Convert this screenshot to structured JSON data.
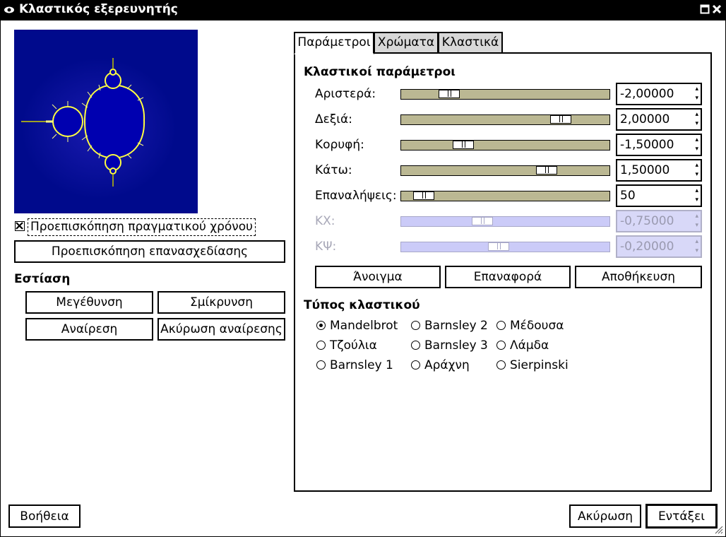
{
  "window": {
    "title": "Κλαστικός εξερευνητής"
  },
  "preview": {
    "realtime_label": "Προεπισκόπηση πραγματικού χρόνου",
    "realtime_checked": true,
    "redraw_label": "Προεπισκόπηση επανασχεδίασης"
  },
  "zoom": {
    "heading": "Εστίαση",
    "zoom_in": "Μεγέθυνση",
    "zoom_out": "Σμίκρυνση",
    "undo": "Αναίρεση",
    "redo": "Ακύρωση αναίρεσης"
  },
  "tabs": [
    {
      "label": "Παράμετροι",
      "active": true
    },
    {
      "label": "Χρώματα",
      "active": false
    },
    {
      "label": "Κλαστικά",
      "active": false
    }
  ],
  "parameters": {
    "heading": "Κλαστικοί παράμετροι",
    "rows": [
      {
        "label": "Αριστερά:",
        "value": "-2,00000",
        "slider_fraction": 0.2,
        "enabled": true
      },
      {
        "label": "Δεξιά:",
        "value": "2,00000",
        "slider_fraction": 0.8,
        "enabled": true
      },
      {
        "label": "Κορυφή:",
        "value": "-1,50000",
        "slider_fraction": 0.275,
        "enabled": true
      },
      {
        "label": "Κάτω:",
        "value": "1,50000",
        "slider_fraction": 0.725,
        "enabled": true
      },
      {
        "label": "Επαναλήψεις:",
        "value": "50",
        "slider_fraction": 0.065,
        "enabled": true
      },
      {
        "label": "ΚΧ:",
        "value": "-0,75000",
        "slider_fraction": 0.38,
        "enabled": false
      },
      {
        "label": "ΚΨ:",
        "value": "-0,20000",
        "slider_fraction": 0.465,
        "enabled": false
      }
    ],
    "open": "Άνοιγμα",
    "reset": "Επαναφορά",
    "save": "Αποθήκευση"
  },
  "fractal_type": {
    "heading": "Τύπος κλαστικού",
    "options": [
      {
        "label": "Mandelbrot",
        "selected": true
      },
      {
        "label": "Barnsley 2",
        "selected": false
      },
      {
        "label": "Μέδουσα",
        "selected": false
      },
      {
        "label": "Τζούλια",
        "selected": false
      },
      {
        "label": "Barnsley 3",
        "selected": false
      },
      {
        "label": "Λάμδα",
        "selected": false
      },
      {
        "label": "Barnsley 1",
        "selected": false
      },
      {
        "label": "Αράχνη",
        "selected": false
      },
      {
        "label": "Sierpinski",
        "selected": false
      }
    ]
  },
  "footer": {
    "help": "Βοήθεια",
    "cancel": "Ακύρωση",
    "ok": "Εντάξει"
  },
  "colors": {
    "preview_background": "#000a8c",
    "slider": "#bbb893",
    "slider_disabled": "#cbcbf8"
  }
}
